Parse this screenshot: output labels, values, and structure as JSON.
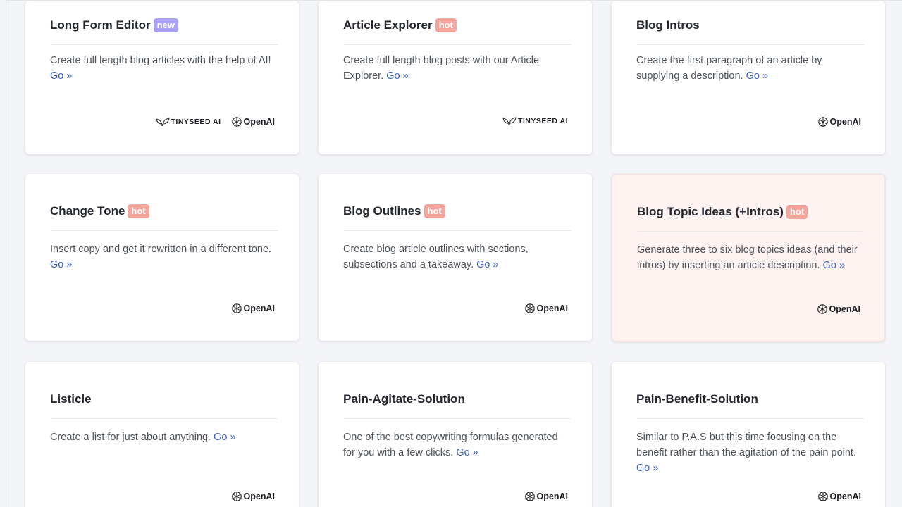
{
  "cards": [
    {
      "title": "Long Form Editor",
      "badge": "new",
      "desc": "Create full length blog articles with the help of AI!",
      "link": "Go »",
      "brands": {
        "tinyseed": "TINYSEED AI",
        "openai": "OpenAI"
      }
    },
    {
      "title": "Article Explorer",
      "badge": "hot",
      "desc": "Create full length blog posts with our Article Explorer.",
      "link": "Go »",
      "brands": {
        "tinyseed": "TINYSEED AI"
      }
    },
    {
      "title": "Blog Intros",
      "badge": "",
      "desc": "Create the first paragraph of an article by supplying a description.",
      "link": "Go »",
      "brands": {
        "openai": "OpenAI"
      }
    },
    {
      "title": "Change Tone",
      "badge": "hot",
      "desc": "Insert copy and get it rewritten in a different tone.",
      "link": "Go »",
      "brands": {
        "openai": "OpenAI"
      }
    },
    {
      "title": "Blog Outlines",
      "badge": "hot",
      "desc": "Create blog article outlines with sections, subsections and a takeaway.",
      "link": "Go »",
      "brands": {
        "openai": "OpenAI"
      }
    },
    {
      "title": "Blog Topic Ideas (+Intros)",
      "badge": "hot",
      "desc": "Generate three to six blog topics ideas (and their intros) by inserting an article description.",
      "link": "Go »",
      "brands": {
        "openai": "OpenAI"
      }
    },
    {
      "title": "Listicle",
      "badge": "",
      "desc": "Create a list for just about anything.",
      "link": "Go »",
      "brands": {
        "openai": "OpenAI"
      }
    },
    {
      "title": "Pain-Agitate-Solution",
      "badge": "",
      "desc": "One of the best copywriting formulas generated for you with a few clicks.",
      "link": "Go »",
      "brands": {
        "openai": "OpenAI"
      }
    },
    {
      "title": "Pain-Benefit-Solution",
      "badge": "",
      "desc": "Similar to P.A.S but this time focusing on the benefit rather than the agitation of the pain point.",
      "link": "Go »",
      "brands": {
        "openai": "OpenAI"
      }
    }
  ],
  "icons": {
    "openai": "openai-logo-icon",
    "tinyseed": "tinyseed-sprout-icon"
  },
  "colors": {
    "hot_badge": "#f6a59c",
    "new_badge": "#a9a2f5",
    "link": "#3d62c9",
    "highlight_card": "#fff3f2"
  }
}
